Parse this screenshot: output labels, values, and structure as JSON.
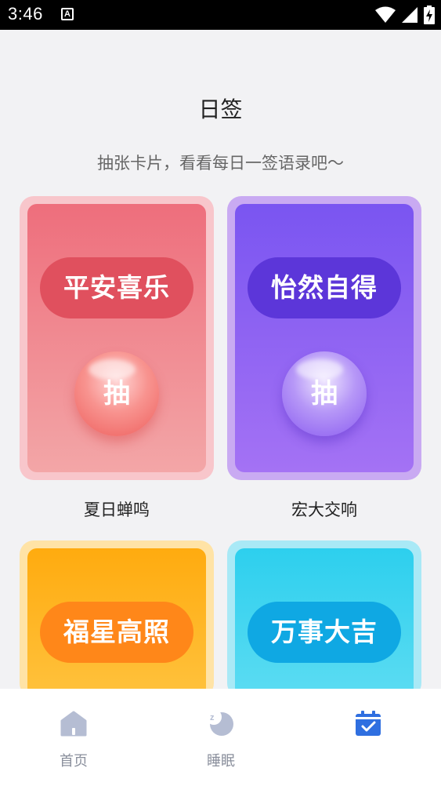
{
  "status_bar": {
    "time": "3:46",
    "notification_icon": "A"
  },
  "header": {
    "title": "日签",
    "subtitle": "抽张卡片，看看每日一签语录吧～"
  },
  "cards": [
    {
      "phrase": "平安喜乐",
      "button": "抽",
      "label": "夏日蝉鸣"
    },
    {
      "phrase": "怡然自得",
      "button": "抽",
      "label": "宏大交响"
    },
    {
      "phrase": "福星高照"
    },
    {
      "phrase": "万事大吉"
    }
  ],
  "nav": {
    "items": [
      {
        "label": "首页",
        "icon": "home-icon"
      },
      {
        "label": "睡眠",
        "icon": "moon-sleep-icon"
      },
      {
        "label": "",
        "icon": "calendar-check-icon"
      }
    ],
    "active_color": "#2f6fe0",
    "inactive_color": "#b5bdd3"
  }
}
